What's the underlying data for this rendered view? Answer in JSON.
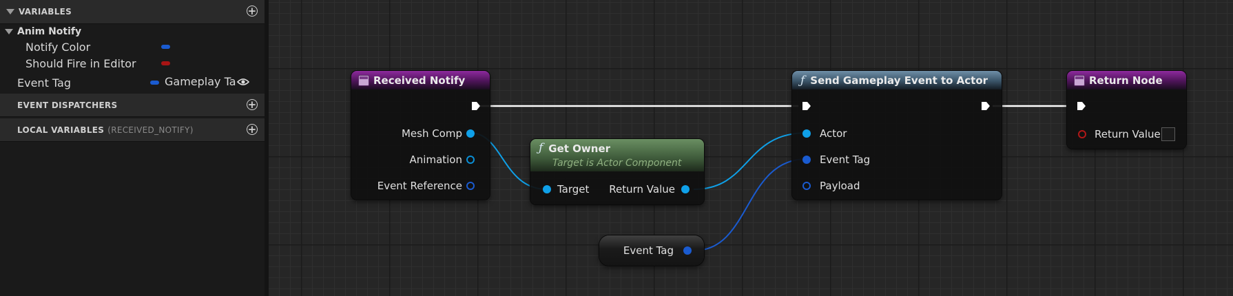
{
  "sidebar": {
    "variables_header": "VARIABLES",
    "anim_notify_group": "Anim Notify",
    "vars": [
      {
        "name": "Notify Color",
        "color": "#1a5bd0"
      },
      {
        "name": "Should Fire in Editor",
        "color": "#a81414"
      }
    ],
    "event_tag": {
      "name": "Event Tag",
      "value": "Gameplay Ta",
      "color": "#1a5bd0"
    },
    "dispatchers_header": "EVENT DISPATCHERS",
    "local_header": "LOCAL VARIABLES",
    "local_header_scope": "(RECEIVED_NOTIFY)"
  },
  "graph": {
    "received_notify": {
      "title": "Received Notify",
      "pins": [
        "Mesh Comp",
        "Animation",
        "Event Reference"
      ]
    },
    "get_owner": {
      "title": "Get Owner",
      "subtitle": "Target is Actor Component",
      "input": "Target",
      "output": "Return Value"
    },
    "send_event": {
      "title": "Send Gameplay Event to Actor",
      "pins": [
        "Actor",
        "Event Tag",
        "Payload"
      ]
    },
    "return_node": {
      "title": "Return Node",
      "pin": "Return Value"
    },
    "event_tag_var": {
      "label": "Event Tag"
    }
  },
  "colors": {
    "object_pin": "#0fa0e8",
    "struct_pin": "#1a5bd0",
    "bool_pin": "#b01818",
    "event_header": "#8e2a9e",
    "function_header": "#3a5468",
    "pure_header": "#3e5a3a"
  }
}
